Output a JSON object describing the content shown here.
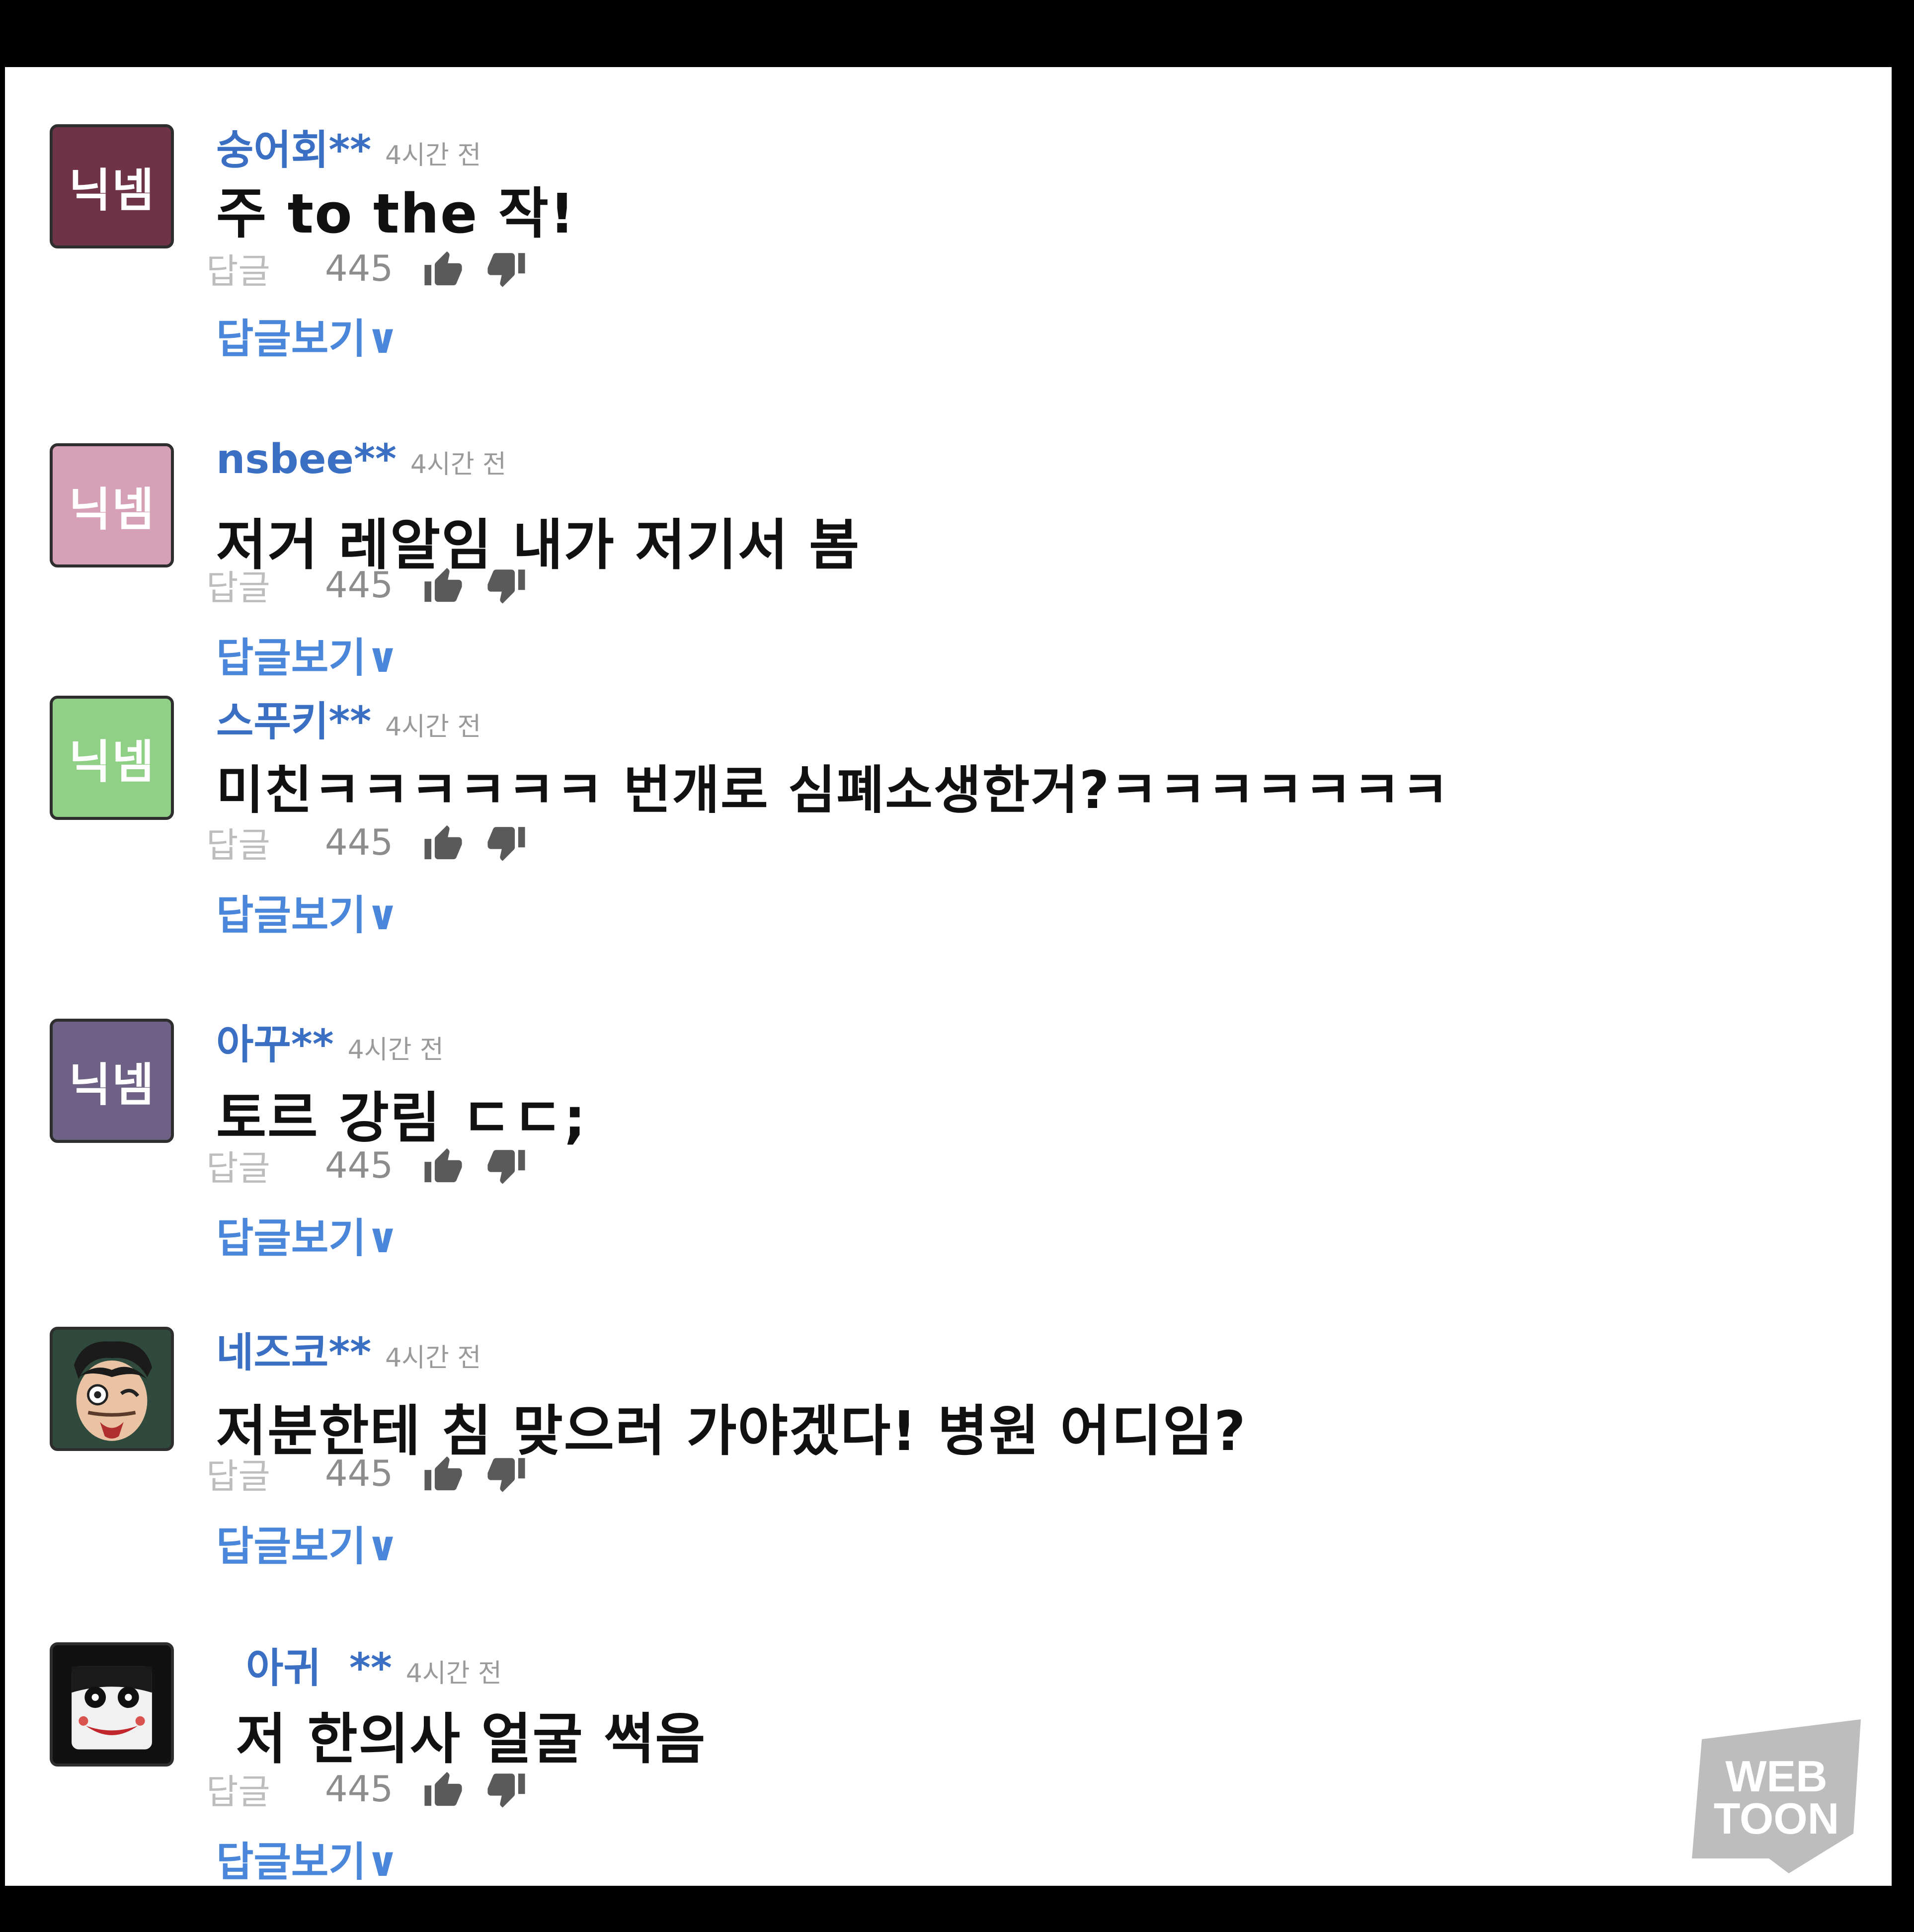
{
  "comments": [
    {
      "avatar_type": "placeholder",
      "avatar_text": "닉넴",
      "avatar_color": "#6f3347",
      "username": "숭어회**",
      "timestamp": "4시간 전",
      "text": "주 to the 작!",
      "reply_label": "답글",
      "likes": "445",
      "view_replies": "답글보기∨"
    },
    {
      "avatar_type": "placeholder",
      "avatar_text": "닉넴",
      "avatar_color": "#d6a1b6",
      "username": "nsbee**",
      "timestamp": "4시간 전",
      "text": "저거 레알임 내가 저기서 봄",
      "reply_label": "답글",
      "likes": "445",
      "view_replies": "답글보기∨"
    },
    {
      "avatar_type": "placeholder",
      "avatar_text": "닉넴",
      "avatar_color": "#8fcf86",
      "username": "스푸키**",
      "timestamp": "4시간 전",
      "text": "미친ㅋㅋㅋㅋㅋㅋ 번개로 심폐소생한거?ㅋㅋㅋㅋㅋㅋㅋ",
      "reply_label": "답글",
      "likes": "445",
      "view_replies": "답글보기∨"
    },
    {
      "avatar_type": "placeholder",
      "avatar_text": "닉넴",
      "avatar_color": "#6d6285",
      "username": "아꾸**",
      "timestamp": "4시간 전",
      "text": "토르 강림 ㄷㄷ;",
      "reply_label": "답글",
      "likes": "445",
      "view_replies": "답글보기∨"
    },
    {
      "avatar_type": "face-cartoon",
      "avatar_color": "#2f4a3c",
      "username": "네즈코**",
      "timestamp": "4시간 전",
      "text": "저분한테 침 맞으러 가야겠다! 병원 어디임?",
      "reply_label": "답글",
      "likes": "445",
      "view_replies": "답글보기∨"
    },
    {
      "avatar_type": "face-mask",
      "avatar_color": "#111111",
      "username": "아귀  **",
      "timestamp": "4시간 전",
      "text": "저 한의사 얼굴 썩음",
      "reply_label": "답글",
      "likes": "445",
      "view_replies": "답글보기∨"
    }
  ],
  "watermark": {
    "line1": "WEB",
    "line2": "TOON",
    "color": "#bdbdbd"
  },
  "colors": {
    "username": "#3a6fc4",
    "view_replies": "#4a86d9",
    "thumb": "#5a5a5a"
  }
}
